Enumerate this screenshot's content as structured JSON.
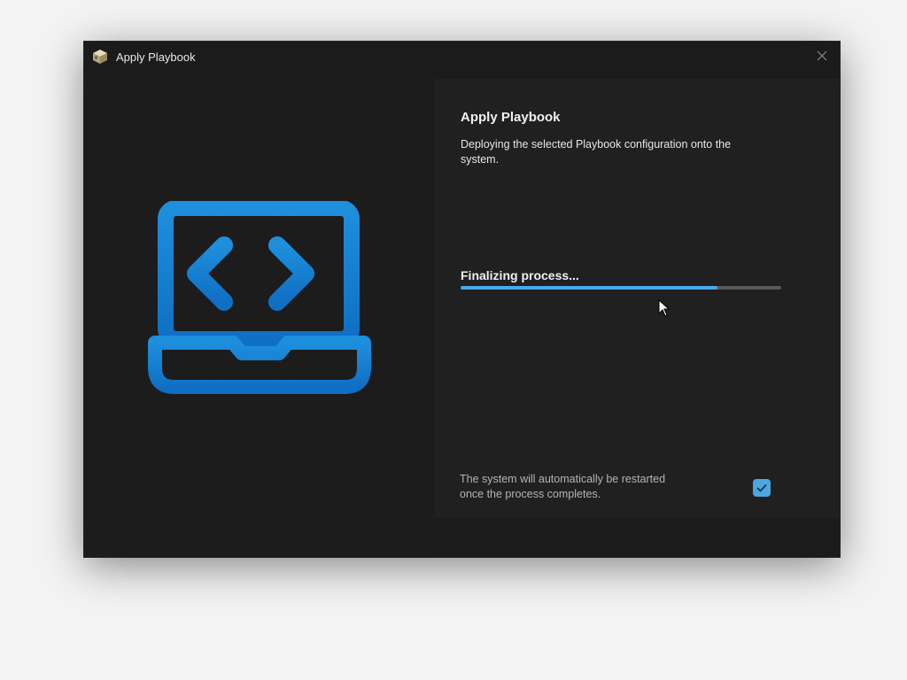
{
  "window": {
    "title": "Apply Playbook"
  },
  "main": {
    "heading": "Apply Playbook",
    "description": "Deploying the selected Playbook configuration onto the system.",
    "status_text": "Finalizing process...",
    "progress_fraction": 0.8,
    "restart_note": "The system will automatically be restarted once the process completes.",
    "restart_checkbox_checked": true
  },
  "icons": {
    "app": "playbook-box-icon",
    "hero": "laptop-code-icon",
    "close": "close-icon",
    "check": "checkmark-icon",
    "cursor": "mouse-cursor-icon"
  },
  "colors": {
    "accent": "#4aa8e6",
    "hero_top": "#1e8fdc",
    "hero_bottom": "#0f6fc4",
    "background": "#1b1b1b"
  }
}
